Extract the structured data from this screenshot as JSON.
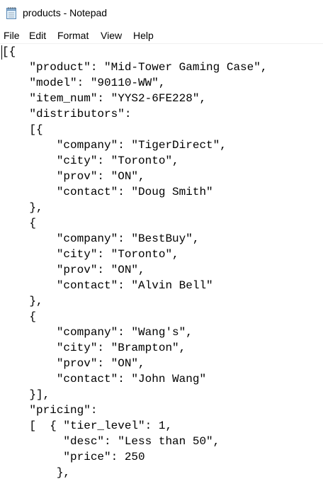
{
  "window": {
    "title": "products - Notepad",
    "icon": "notepad-icon"
  },
  "menu": {
    "items": [
      "File",
      "Edit",
      "Format",
      "View",
      "Help"
    ]
  },
  "editor": {
    "lines": [
      "[{",
      "    \"product\": \"Mid-Tower Gaming Case\",",
      "    \"model\": \"90110-WW\",",
      "    \"item_num\": \"YYS2-6FE228\",",
      "    \"distributors\":",
      "    [{",
      "        \"company\": \"TigerDirect\",",
      "        \"city\": \"Toronto\",",
      "        \"prov\": \"ON\",",
      "        \"contact\": \"Doug Smith\"",
      "    },",
      "    {",
      "        \"company\": \"BestBuy\",",
      "        \"city\": \"Toronto\",",
      "        \"prov\": \"ON\",",
      "        \"contact\": \"Alvin Bell\"",
      "    },",
      "    {",
      "        \"company\": \"Wang's\",",
      "        \"city\": \"Brampton\",",
      "        \"prov\": \"ON\",",
      "        \"contact\": \"John Wang\"",
      "    }],",
      "    \"pricing\":",
      "    [  { \"tier_level\": 1,",
      "         \"desc\": \"Less than 50\",",
      "         \"price\": 250",
      "        },"
    ]
  }
}
